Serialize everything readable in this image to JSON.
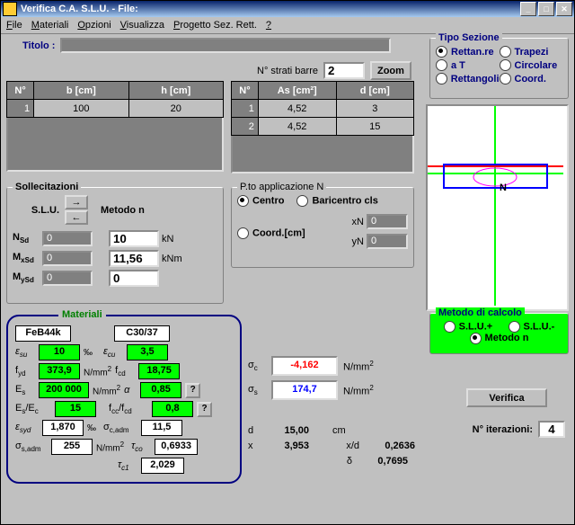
{
  "window": {
    "title": "Verifica C.A. S.L.U. - File:"
  },
  "menu": {
    "file": "File",
    "materiali": "Materiali",
    "opzioni": "Opzioni",
    "visualizza": "Visualizza",
    "progetto": "Progetto Sez. Rett.",
    "help": "?"
  },
  "titolo": {
    "label": "Titolo :",
    "value": ""
  },
  "strati": {
    "label": "N° strati barre",
    "value": "2",
    "zoom": "Zoom"
  },
  "tipo_sezione": {
    "legend": "Tipo Sezione",
    "rettanre": "Rettan.re",
    "trapezi": "Trapezi",
    "aT": "a T",
    "circolare": "Circolare",
    "rettangoli": "Rettangoli",
    "coord": "Coord.",
    "selected": "rettanre"
  },
  "tab1": {
    "headers": {
      "n": "N°",
      "b": "b [cm]",
      "h": "h [cm]"
    },
    "rows": [
      {
        "n": "1",
        "b": "100",
        "h": "20"
      }
    ]
  },
  "tab2": {
    "headers": {
      "n": "N°",
      "as": "As [cm²]",
      "d": "d [cm]"
    },
    "rows": [
      {
        "n": "1",
        "as": "4,52",
        "d": "3"
      },
      {
        "n": "2",
        "as": "4,52",
        "d": "15"
      }
    ]
  },
  "soll": {
    "legend": "Sollecitazioni",
    "slu": "S.L.U.",
    "metodo_n": "Metodo n",
    "Nsd": "0",
    "Mxsd": "0",
    "Mysd": "0",
    "kN": "kN",
    "kNm": "kNm",
    "val_kN": "10",
    "val_kNm": "11,56",
    "val3": "0"
  },
  "ptoN": {
    "legend": "P.to applicazione N",
    "centro": "Centro",
    "bari": "Baricentro cls",
    "coord": "Coord.[cm]",
    "xn_label": "xN",
    "yn_label": "yN",
    "xn": "0",
    "yn": "0",
    "selected": "centro"
  },
  "metodo_calcolo": {
    "legend": "Metodo di calcolo",
    "slu_plus": "S.L.U.+",
    "slu_minus": "S.L.U.-",
    "metodo_n": "Metodo n",
    "selected": "metodo_n"
  },
  "materiali": {
    "legend": "Materiali",
    "steel": "FeB44k",
    "conc": "C30/37",
    "eps_su": "10",
    "eps_cu": "3,5",
    "fyd": "373,9",
    "fcd": "18,75",
    "Es": "200 000",
    "alpha": "0,85",
    "EsEc": "15",
    "fcc_fcd": "0,8",
    "eps_syd": "1,870",
    "sigma_cadm": "11,5",
    "sigma_sadm": "255",
    "tau_co": "0,6933",
    "tau_c1": "2,029",
    "unit_permille": "‰",
    "unit_Nmm2": "N/mm"
  },
  "results": {
    "sigma_c_label": "σ",
    "sigma_c_sub": "c",
    "sigma_c": "-4,162",
    "sigma_s_label": "σ",
    "sigma_s_sub": "s",
    "sigma_s": "174,7",
    "unit": "N/mm",
    "d_label": "d",
    "d_val": "15,00",
    "d_unit": "cm",
    "x_label": "x",
    "x_val": "3,953",
    "xd_label": "x/d",
    "xd_val": "0,2636",
    "delta_label": "δ",
    "delta_val": "0,7695"
  },
  "verifica": {
    "button": "Verifica",
    "iter_label": "N° iterazioni:",
    "iter": "4"
  },
  "preview_label": "N"
}
